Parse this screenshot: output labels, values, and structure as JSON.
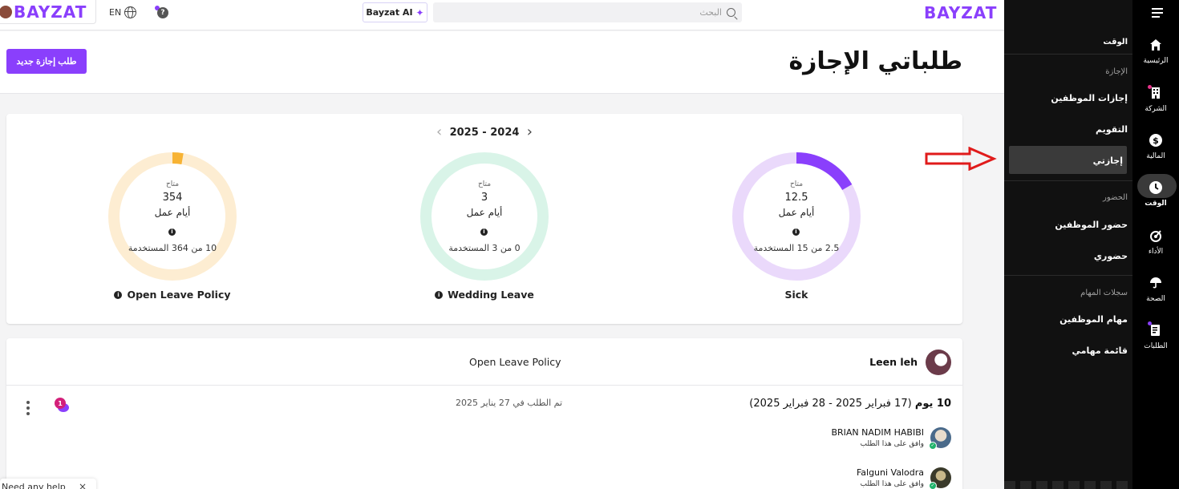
{
  "topbar": {
    "logo": "BAYZAT",
    "lang": "EN",
    "ai_button": "Bayzat AI",
    "search_placeholder": "البحث"
  },
  "page": {
    "title": "طلباتي الإجازة",
    "new_request_button": "طلب إجازة جديد"
  },
  "summary": {
    "year_range": "2025 - 2024",
    "available_label": "متاح",
    "unit_label": "أيام عمل",
    "policies": [
      {
        "name": "Sick",
        "available": "12.5",
        "used_text": "2.5 من 15 المستخدمة",
        "used": 2.5,
        "total": 15,
        "has_info": false,
        "color": "#8a3ffc",
        "track": "#ead9fb"
      },
      {
        "name": "Wedding Leave",
        "available": "3",
        "used_text": "0 من 3 المستخدمة",
        "used": 0,
        "total": 3,
        "has_info": true,
        "color": "#2fbf80",
        "track": "#d9f4e8"
      },
      {
        "name": "Open Leave Policy",
        "available": "354",
        "used_text": "10 من 364 المستخدمة",
        "used": 10,
        "total": 364,
        "has_info": true,
        "color": "#f7b334",
        "track": "#fdedd2"
      }
    ]
  },
  "request": {
    "employee_name": "Leen         leh",
    "policy": "Open Leave Policy",
    "days_bold": "10 يوم",
    "days_range": "(17 فبراير 2025 - 28 فبراير 2025)",
    "requested_on": "تم الطلب في 27 يناير 2025",
    "comment_count": "1",
    "approvers": [
      {
        "name": "BRIAN NADIM HABIBI",
        "status": "وافق على هذا الطلب"
      },
      {
        "name": "Falguni Valodra",
        "status": "وافق على هذا الطلب"
      }
    ]
  },
  "help_popup": {
    "text": "Need any help",
    "close": "×"
  },
  "sub_sidebar": {
    "header": "الوقت",
    "section_leave": "الإجازة",
    "leave_items": [
      "إجازات الموظفين",
      "التقويم",
      "إجازتي"
    ],
    "section_attendance": "الحضور",
    "attendance_items": [
      "حضور الموظفين",
      "حضوري"
    ],
    "section_tasks": "سجلات المهام",
    "task_items": [
      "مهام الموظفين",
      "قائمة مهامي"
    ]
  },
  "main_sidebar": {
    "items": [
      {
        "label": "الرئيسية",
        "icon": "home-icon"
      },
      {
        "label": "الشركة",
        "icon": "building-icon"
      },
      {
        "label": "المالية",
        "icon": "dollar-icon"
      },
      {
        "label": "الوقت",
        "icon": "clock-icon"
      },
      {
        "label": "الأداء",
        "icon": "target-icon"
      },
      {
        "label": "الصحة",
        "icon": "umbrella-icon"
      },
      {
        "label": "الطلبات",
        "icon": "document-icon"
      }
    ]
  }
}
